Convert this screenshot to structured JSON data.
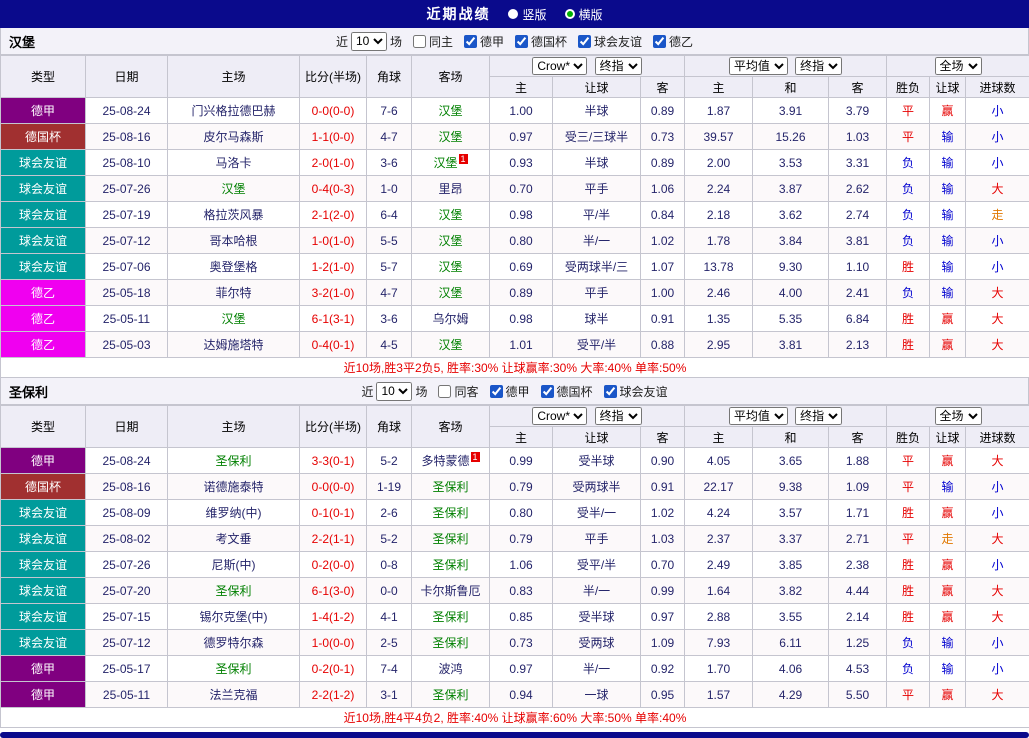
{
  "topbar": {
    "title": "近期战绩",
    "options": [
      {
        "label": "竖版",
        "selected": false
      },
      {
        "label": "横版",
        "selected": true
      }
    ]
  },
  "filter_labels": {
    "prefix": "近",
    "suffix": "场"
  },
  "table_header": {
    "type": "类型",
    "date": "日期",
    "home": "主场",
    "score": "比分(半场)",
    "corner": "角球",
    "away": "客场",
    "asian_provider": "Crow*",
    "asian_stage": "终指",
    "euro_provider": "平均值",
    "euro_stage": "终指",
    "scope": "全场",
    "asian_home": "主",
    "asian_handicap": "让球",
    "asian_away": "客",
    "euro_home": "主",
    "euro_draw": "和",
    "euro_away": "客",
    "result": "胜负",
    "handicap_result": "让球",
    "goals": "进球数"
  },
  "colors": {
    "topbar_bg": "#0A0A8C",
    "league_colors": {
      "德甲": "#800080",
      "德国杯": "#A13030",
      "球会友谊": "#009B9B",
      "德乙": "#F000F0"
    },
    "subject_team": "#008000",
    "neutral_team": "#24246A",
    "score": "#E60000",
    "result_map": {
      "胜": "#E60000",
      "平": "#E60000",
      "负": "#0000D0",
      "赢": "#E60000",
      "输": "#0000D0",
      "走": "#E07800",
      "大": "#E60000",
      "小": "#0000D0"
    }
  },
  "sections": [
    {
      "team": "汉堡",
      "filter": {
        "count": "10",
        "same_label": "同主",
        "same_checked": false,
        "leagues": [
          "德甲",
          "德国杯",
          "球会友谊",
          "德乙"
        ]
      },
      "rows": [
        {
          "league": "德甲",
          "date": "25-08-24",
          "home": "门兴格拉德巴赫",
          "home_subject": false,
          "home_card": "",
          "score": "0-0(0-0)",
          "corner": "7-6",
          "away": "汉堡",
          "away_subject": true,
          "away_card": "",
          "asian_home": "1.00",
          "handicap": "半球",
          "asian_away": "0.89",
          "euro_home": "1.87",
          "euro_draw": "3.91",
          "euro_away": "3.79",
          "result": "平",
          "handicap_result": "赢",
          "goals": "小"
        },
        {
          "league": "德国杯",
          "date": "25-08-16",
          "home": "皮尔马森斯",
          "home_subject": false,
          "home_card": "",
          "score": "1-1(0-0)",
          "corner": "4-7",
          "away": "汉堡",
          "away_subject": true,
          "away_card": "",
          "asian_home": "0.97",
          "handicap": "受三/三球半",
          "asian_away": "0.73",
          "euro_home": "39.57",
          "euro_draw": "15.26",
          "euro_away": "1.03",
          "result": "平",
          "handicap_result": "输",
          "goals": "小"
        },
        {
          "league": "球会友谊",
          "date": "25-08-10",
          "home": "马洛卡",
          "home_subject": false,
          "home_card": "",
          "score": "2-0(1-0)",
          "corner": "3-6",
          "away": "汉堡",
          "away_subject": true,
          "away_card": "1",
          "asian_home": "0.93",
          "handicap": "半球",
          "asian_away": "0.89",
          "euro_home": "2.00",
          "euro_draw": "3.53",
          "euro_away": "3.31",
          "result": "负",
          "handicap_result": "输",
          "goals": "小"
        },
        {
          "league": "球会友谊",
          "date": "25-07-26",
          "home": "汉堡",
          "home_subject": true,
          "home_card": "",
          "score": "0-4(0-3)",
          "corner": "1-0",
          "away": "里昂",
          "away_subject": false,
          "away_card": "",
          "asian_home": "0.70",
          "handicap": "平手",
          "asian_away": "1.06",
          "euro_home": "2.24",
          "euro_draw": "3.87",
          "euro_away": "2.62",
          "result": "负",
          "handicap_result": "输",
          "goals": "大"
        },
        {
          "league": "球会友谊",
          "date": "25-07-19",
          "home": "格拉茨风暴",
          "home_subject": false,
          "home_card": "",
          "score": "2-1(2-0)",
          "corner": "6-4",
          "away": "汉堡",
          "away_subject": true,
          "away_card": "",
          "asian_home": "0.98",
          "handicap": "平/半",
          "asian_away": "0.84",
          "euro_home": "2.18",
          "euro_draw": "3.62",
          "euro_away": "2.74",
          "result": "负",
          "handicap_result": "输",
          "goals": "走"
        },
        {
          "league": "球会友谊",
          "date": "25-07-12",
          "home": "哥本哈根",
          "home_subject": false,
          "home_card": "",
          "score": "1-0(1-0)",
          "corner": "5-5",
          "away": "汉堡",
          "away_subject": true,
          "away_card": "",
          "asian_home": "0.80",
          "handicap": "半/一",
          "asian_away": "1.02",
          "euro_home": "1.78",
          "euro_draw": "3.84",
          "euro_away": "3.81",
          "result": "负",
          "handicap_result": "输",
          "goals": "小"
        },
        {
          "league": "球会友谊",
          "date": "25-07-06",
          "home": "奥登堡格",
          "home_subject": false,
          "home_card": "",
          "score": "1-2(1-0)",
          "corner": "5-7",
          "away": "汉堡",
          "away_subject": true,
          "away_card": "",
          "asian_home": "0.69",
          "handicap": "受两球半/三",
          "asian_away": "1.07",
          "euro_home": "13.78",
          "euro_draw": "9.30",
          "euro_away": "1.10",
          "result": "胜",
          "handicap_result": "输",
          "goals": "小"
        },
        {
          "league": "德乙",
          "date": "25-05-18",
          "home": "菲尔特",
          "home_subject": false,
          "home_card": "",
          "score": "3-2(1-0)",
          "corner": "4-7",
          "away": "汉堡",
          "away_subject": true,
          "away_card": "",
          "asian_home": "0.89",
          "handicap": "平手",
          "asian_away": "1.00",
          "euro_home": "2.46",
          "euro_draw": "4.00",
          "euro_away": "2.41",
          "result": "负",
          "handicap_result": "输",
          "goals": "大"
        },
        {
          "league": "德乙",
          "date": "25-05-11",
          "home": "汉堡",
          "home_subject": true,
          "home_card": "",
          "score": "6-1(3-1)",
          "corner": "3-6",
          "away": "乌尔姆",
          "away_subject": false,
          "away_card": "",
          "asian_home": "0.98",
          "handicap": "球半",
          "asian_away": "0.91",
          "euro_home": "1.35",
          "euro_draw": "5.35",
          "euro_away": "6.84",
          "result": "胜",
          "handicap_result": "赢",
          "goals": "大"
        },
        {
          "league": "德乙",
          "date": "25-05-03",
          "home": "达姆施塔特",
          "home_subject": false,
          "home_card": "",
          "score": "0-4(0-1)",
          "corner": "4-5",
          "away": "汉堡",
          "away_subject": true,
          "away_card": "",
          "asian_home": "1.01",
          "handicap": "受平/半",
          "asian_away": "0.88",
          "euro_home": "2.95",
          "euro_draw": "3.81",
          "euro_away": "2.13",
          "result": "胜",
          "handicap_result": "赢",
          "goals": "大"
        }
      ],
      "summary": "近10场,胜3平2负5, 胜率:30% 让球赢率:30% 大率:40% 单率:50%"
    },
    {
      "team": "圣保利",
      "filter": {
        "count": "10",
        "same_label": "同客",
        "same_checked": false,
        "leagues": [
          "德甲",
          "德国杯",
          "球会友谊"
        ]
      },
      "rows": [
        {
          "league": "德甲",
          "date": "25-08-24",
          "home": "圣保利",
          "home_subject": true,
          "home_card": "",
          "score": "3-3(0-1)",
          "corner": "5-2",
          "away": "多特蒙德",
          "away_subject": false,
          "away_card": "1",
          "asian_home": "0.99",
          "handicap": "受半球",
          "asian_away": "0.90",
          "euro_home": "4.05",
          "euro_draw": "3.65",
          "euro_away": "1.88",
          "result": "平",
          "handicap_result": "赢",
          "goals": "大"
        },
        {
          "league": "德国杯",
          "date": "25-08-16",
          "home": "诺德施泰特",
          "home_subject": false,
          "home_card": "",
          "score": "0-0(0-0)",
          "corner": "1-19",
          "away": "圣保利",
          "away_subject": true,
          "away_card": "",
          "asian_home": "0.79",
          "handicap": "受两球半",
          "asian_away": "0.91",
          "euro_home": "22.17",
          "euro_draw": "9.38",
          "euro_away": "1.09",
          "result": "平",
          "handicap_result": "输",
          "goals": "小"
        },
        {
          "league": "球会友谊",
          "date": "25-08-09",
          "home": "维罗纳(中)",
          "home_subject": false,
          "home_card": "",
          "score": "0-1(0-1)",
          "corner": "2-6",
          "away": "圣保利",
          "away_subject": true,
          "away_card": "",
          "asian_home": "0.80",
          "handicap": "受半/一",
          "asian_away": "1.02",
          "euro_home": "4.24",
          "euro_draw": "3.57",
          "euro_away": "1.71",
          "result": "胜",
          "handicap_result": "赢",
          "goals": "小"
        },
        {
          "league": "球会友谊",
          "date": "25-08-02",
          "home": "考文垂",
          "home_subject": false,
          "home_card": "",
          "score": "2-2(1-1)",
          "corner": "5-2",
          "away": "圣保利",
          "away_subject": true,
          "away_card": "",
          "asian_home": "0.79",
          "handicap": "平手",
          "asian_away": "1.03",
          "euro_home": "2.37",
          "euro_draw": "3.37",
          "euro_away": "2.71",
          "result": "平",
          "handicap_result": "走",
          "goals": "大"
        },
        {
          "league": "球会友谊",
          "date": "25-07-26",
          "home": "尼斯(中)",
          "home_subject": false,
          "home_card": "",
          "score": "0-2(0-0)",
          "corner": "0-8",
          "away": "圣保利",
          "away_subject": true,
          "away_card": "",
          "asian_home": "1.06",
          "handicap": "受平/半",
          "asian_away": "0.70",
          "euro_home": "2.49",
          "euro_draw": "3.85",
          "euro_away": "2.38",
          "result": "胜",
          "handicap_result": "赢",
          "goals": "小"
        },
        {
          "league": "球会友谊",
          "date": "25-07-20",
          "home": "圣保利",
          "home_subject": true,
          "home_card": "",
          "score": "6-1(3-0)",
          "corner": "0-0",
          "away": "卡尔斯鲁厄",
          "away_subject": false,
          "away_card": "",
          "asian_home": "0.83",
          "handicap": "半/一",
          "asian_away": "0.99",
          "euro_home": "1.64",
          "euro_draw": "3.82",
          "euro_away": "4.44",
          "result": "胜",
          "handicap_result": "赢",
          "goals": "大"
        },
        {
          "league": "球会友谊",
          "date": "25-07-15",
          "home": "锡尔克堡(中)",
          "home_subject": false,
          "home_card": "",
          "score": "1-4(1-2)",
          "corner": "4-1",
          "away": "圣保利",
          "away_subject": true,
          "away_card": "",
          "asian_home": "0.85",
          "handicap": "受半球",
          "asian_away": "0.97",
          "euro_home": "2.88",
          "euro_draw": "3.55",
          "euro_away": "2.14",
          "result": "胜",
          "handicap_result": "赢",
          "goals": "大"
        },
        {
          "league": "球会友谊",
          "date": "25-07-12",
          "home": "德罗特尔森",
          "home_subject": false,
          "home_card": "",
          "score": "1-0(0-0)",
          "corner": "2-5",
          "away": "圣保利",
          "away_subject": true,
          "away_card": "",
          "asian_home": "0.73",
          "handicap": "受两球",
          "asian_away": "1.09",
          "euro_home": "7.93",
          "euro_draw": "6.11",
          "euro_away": "1.25",
          "result": "负",
          "handicap_result": "输",
          "goals": "小"
        },
        {
          "league": "德甲",
          "date": "25-05-17",
          "home": "圣保利",
          "home_subject": true,
          "home_card": "",
          "score": "0-2(0-1)",
          "corner": "7-4",
          "away": "波鸿",
          "away_subject": false,
          "away_card": "",
          "asian_home": "0.97",
          "handicap": "半/一",
          "asian_away": "0.92",
          "euro_home": "1.70",
          "euro_draw": "4.06",
          "euro_away": "4.53",
          "result": "负",
          "handicap_result": "输",
          "goals": "小"
        },
        {
          "league": "德甲",
          "date": "25-05-11",
          "home": "法兰克福",
          "home_subject": false,
          "home_card": "",
          "score": "2-2(1-2)",
          "corner": "3-1",
          "away": "圣保利",
          "away_subject": true,
          "away_card": "",
          "asian_home": "0.94",
          "handicap": "一球",
          "asian_away": "0.95",
          "euro_home": "1.57",
          "euro_draw": "4.29",
          "euro_away": "5.50",
          "result": "平",
          "handicap_result": "赢",
          "goals": "大"
        }
      ],
      "summary": "近10场,胜4平4负2, 胜率:40% 让球赢率:60% 大率:50% 单率:40%"
    }
  ]
}
